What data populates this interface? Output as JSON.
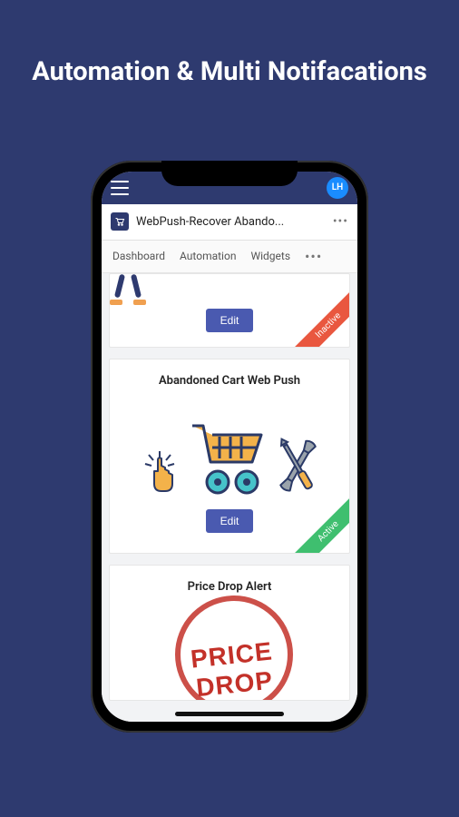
{
  "promo": {
    "headline": "Automation & Multi Notifacations"
  },
  "topbar": {
    "avatar_initials": "LH"
  },
  "titlebar": {
    "app_name": "WebPush-Recover Abando..."
  },
  "tabs": {
    "items": [
      {
        "label": "Dashboard"
      },
      {
        "label": "Automation"
      },
      {
        "label": "Widgets"
      }
    ]
  },
  "cards": {
    "card0": {
      "edit_label": "Edit",
      "ribbon": "Inactive"
    },
    "card1": {
      "title": "Abandoned Cart Web Push",
      "edit_label": "Edit",
      "ribbon": "Active"
    },
    "card2": {
      "title": "Price Drop Alert",
      "stamp_text": "PRICE DROP"
    }
  }
}
